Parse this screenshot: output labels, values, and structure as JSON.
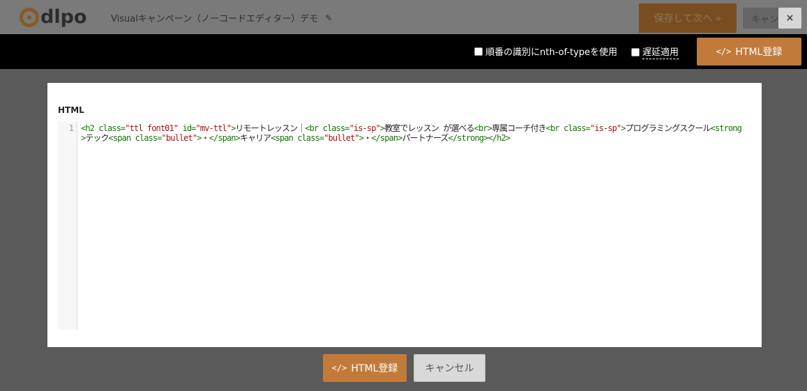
{
  "header": {
    "logo_text": "dlpo",
    "title": "Visualキャンペーン（ノーコードエディター）デモ",
    "save_next_label": "保存して次へ »",
    "cancel_label": "キャンセル",
    "close_label": "×"
  },
  "toolbar": {
    "nth_option_label": "順番の識別にnth-of-typeを使用",
    "delay_option_label": "遅延適用",
    "html_register_label": "HTML登録"
  },
  "editor": {
    "section_label": "HTML",
    "line_number": "1",
    "code": "<h2 class=\"ttl font01\" id=\"mv-ttl\">リモートレッスン｜<br class=\"is-sp\">教室でレッスン が選べる<br>専属コーチ付き<br class=\"is-sp\">プログラミングスクール<strong>テック<span class=\"bullet\">・</span>キャリア<span class=\"bullet\">・</span>パートナーズ</strong></h2>"
  },
  "footer": {
    "html_register_label": "HTML登録",
    "cancel_label": "キャンセル"
  },
  "icons": {
    "pencil": "pencil-icon",
    "code": "code-icon",
    "close": "close-icon"
  }
}
